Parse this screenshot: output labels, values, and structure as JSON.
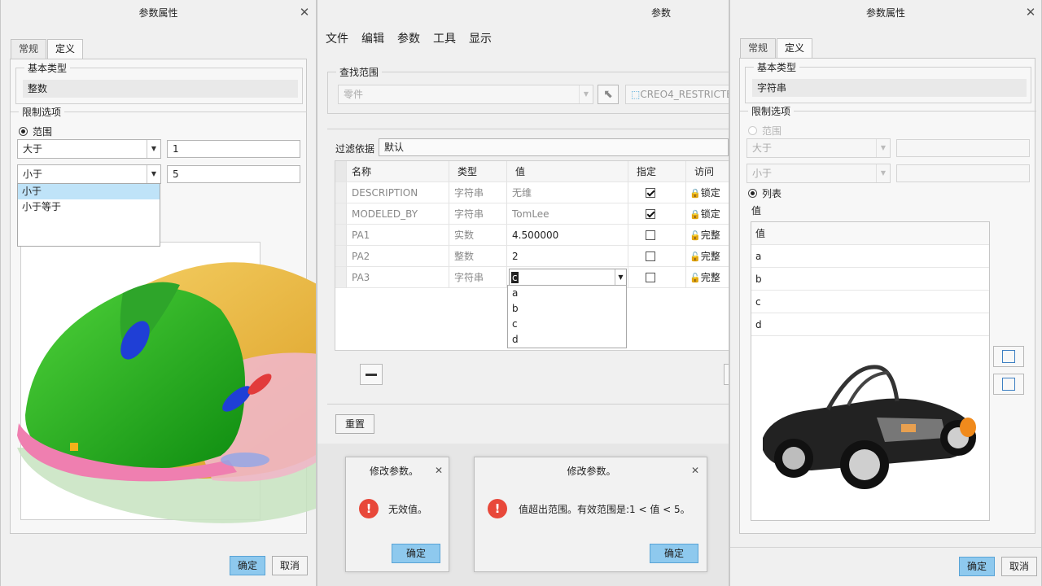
{
  "left_dialog": {
    "title": "参数属性",
    "tabs": [
      "常规",
      "定义"
    ],
    "basic_type_label": "基本类型",
    "basic_type_value": "整数",
    "limit_label": "限制选项",
    "range_label": "范围",
    "combo1_value": "大于",
    "field1_value": "1",
    "combo2_value": "小于",
    "field2_value": "5",
    "dropdown_items": [
      "小于",
      "小于等于"
    ],
    "ok": "确定",
    "cancel": "取消"
  },
  "middle_window": {
    "title": "参数",
    "menu": [
      "文件",
      "编辑",
      "参数",
      "工具",
      "显示"
    ],
    "search_scope_label": "查找范围",
    "scope_value": "零件",
    "model_name": "CREO4_RESTRICTE",
    "filter_label": "过滤依据",
    "filter_value": "默认",
    "columns": [
      "名称",
      "类型",
      "值",
      "指定",
      "访问"
    ],
    "rows": [
      {
        "name": "DESCRIPTION",
        "type": "字符串",
        "value": "无维",
        "designate": true,
        "access": "锁定"
      },
      {
        "name": "MODELED_BY",
        "type": "字符串",
        "value": "TomLee",
        "designate": true,
        "access": "锁定"
      },
      {
        "name": "PA1",
        "type": "实数",
        "value": "4.500000",
        "designate": false,
        "access": "完整"
      },
      {
        "name": "PA2",
        "type": "整数",
        "value": "2",
        "designate": false,
        "access": "完整"
      },
      {
        "name": "PA3",
        "type": "字符串",
        "value": "c",
        "designate": false,
        "access": "完整"
      }
    ],
    "value_dropdown": [
      "a",
      "b",
      "c",
      "d"
    ],
    "reset": "重置"
  },
  "msg1": {
    "title": "修改参数。",
    "text": "无效值。",
    "ok": "确定"
  },
  "msg2": {
    "title": "修改参数。",
    "text": "值超出范围。有效范围是:1 < 值 < 5。",
    "ok": "确定"
  },
  "right_dialog": {
    "title": "参数属性",
    "tabs": [
      "常规",
      "定义"
    ],
    "basic_type_label": "基本类型",
    "basic_type_value": "字符串",
    "limit_label": "限制选项",
    "range_label": "范围",
    "combo1_value": "大于",
    "combo2_value": "小于",
    "list_label": "列表",
    "value_label": "值",
    "list_header": "值",
    "list_items": [
      "a",
      "b",
      "c",
      "d"
    ],
    "ok": "确定",
    "cancel": "取消"
  },
  "colors": {
    "primary_button": "#8ec9ee",
    "selection": "#bfe3f8",
    "error": "#e8483a"
  },
  "icons": [
    "close-icon",
    "chevron-down-icon",
    "select-cursor-icon",
    "part-cube-icon",
    "lock-icon",
    "unlock-icon",
    "error-icon",
    "minus-icon",
    "add-row-icon",
    "move-row-icon"
  ]
}
